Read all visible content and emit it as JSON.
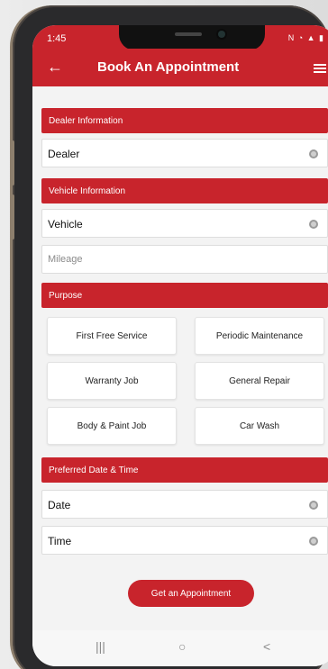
{
  "status": {
    "time": "1:45",
    "icons": "N ◔ ▲ ▮"
  },
  "header": {
    "title": "Book An Appointment",
    "back_icon": "←",
    "menu_icon": "hamburger"
  },
  "sections": {
    "dealer": "Dealer Information",
    "vehicle": "Vehicle Information",
    "purpose": "Purpose",
    "datetime": "Preferred Date & Time"
  },
  "fields": {
    "dealer": {
      "label": "Dealer"
    },
    "vehicle": {
      "label": "Vehicle"
    },
    "mileage": {
      "placeholder": "Mileage"
    },
    "date": {
      "label": "Date"
    },
    "time": {
      "label": "Time"
    }
  },
  "purpose_options": [
    "First Free Service",
    "Periodic Maintenance",
    "Warranty Job",
    "General Repair",
    "Body & Paint Job",
    "Car Wash"
  ],
  "cta_label": "Get an Appointment",
  "navbar": {
    "recent": "|||",
    "home": "○",
    "back": "<"
  },
  "colors": {
    "primary": "#c8242c"
  }
}
